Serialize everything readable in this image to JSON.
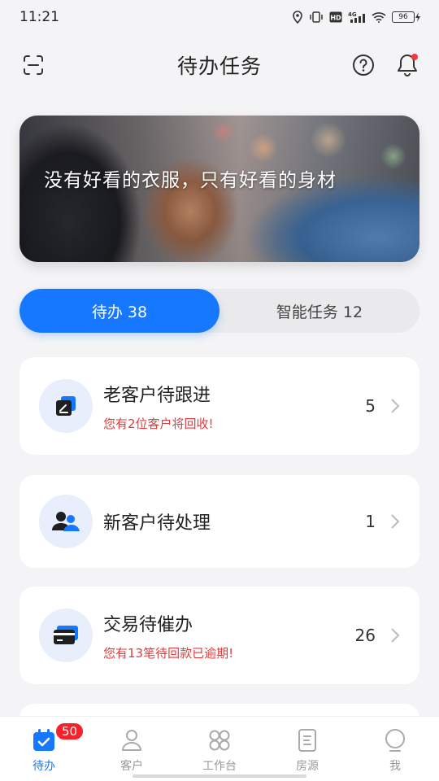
{
  "status_bar": {
    "time": "11:21",
    "battery": "96"
  },
  "header": {
    "title": "待办任务"
  },
  "banner": {
    "slogan": "没有好看的衣服，只有好看的身材"
  },
  "tabs": [
    {
      "label": "待办 38",
      "active": true
    },
    {
      "label": "智能任务 12",
      "active": false
    }
  ],
  "tasks": [
    {
      "title": "老客户待跟进",
      "subtitle": "您有2位客户将回收!",
      "count": "5",
      "icon": "edit-note-icon"
    },
    {
      "title": "新客户待处理",
      "subtitle": "",
      "count": "1",
      "icon": "users-icon"
    },
    {
      "title": "交易待催办",
      "subtitle": "您有13笔待回款已逾期!",
      "count": "26",
      "icon": "card-icon"
    }
  ],
  "tabbar": {
    "badge": "50",
    "items": [
      {
        "label": "待办",
        "icon": "calendar-check-icon",
        "active": true
      },
      {
        "label": "客户",
        "icon": "person-icon",
        "active": false
      },
      {
        "label": "工作台",
        "icon": "grid-icon",
        "active": false
      },
      {
        "label": "房源",
        "icon": "document-icon",
        "active": false
      },
      {
        "label": "我",
        "icon": "profile-icon",
        "active": false
      }
    ]
  },
  "colors": {
    "accent": "#1677ff",
    "alert": "#e23b3b",
    "badge": "#f5222d"
  }
}
